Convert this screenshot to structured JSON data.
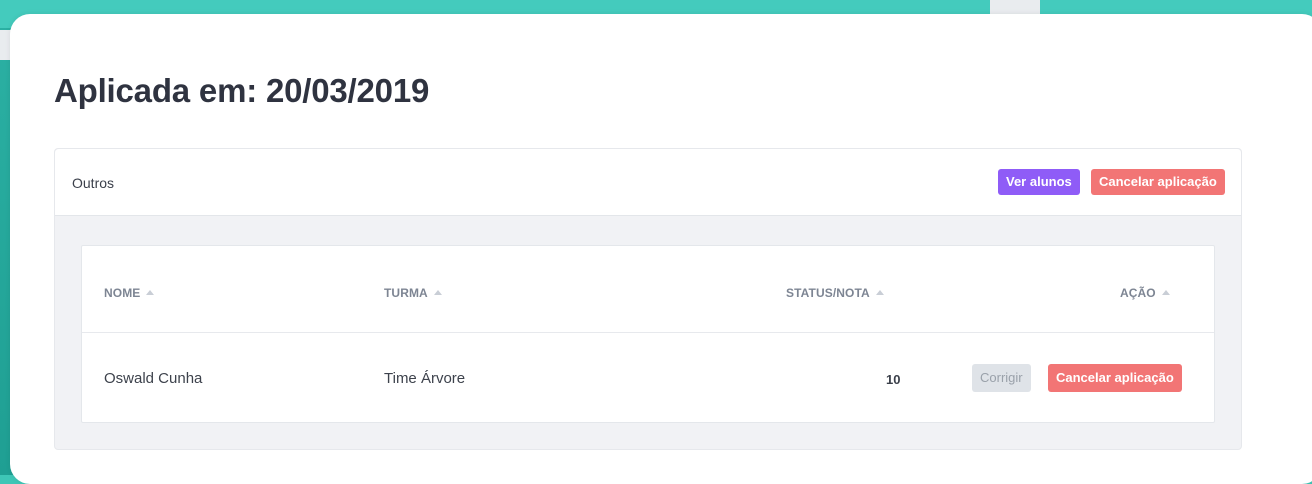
{
  "modal": {
    "title": "Aplicada em: 20/03/2019"
  },
  "panel": {
    "title": "Outros",
    "buttons": {
      "view_students": "Ver alunos",
      "cancel_application": "Cancelar aplicação"
    }
  },
  "table": {
    "columns": [
      "NOME",
      "TURMA",
      "STATUS/NOTA",
      "AÇÃO"
    ],
    "rows": [
      {
        "name": "Oswald Cunha",
        "class": "Time Árvore",
        "score": "10",
        "actions": {
          "correct": "Corrigir",
          "cancel": "Cancelar aplicação"
        }
      }
    ]
  },
  "colors": {
    "background": "#3ec6b6",
    "purple_button": "#8f5cf7",
    "red_button": "#f27575",
    "grey_button": "#dfe3e8"
  }
}
